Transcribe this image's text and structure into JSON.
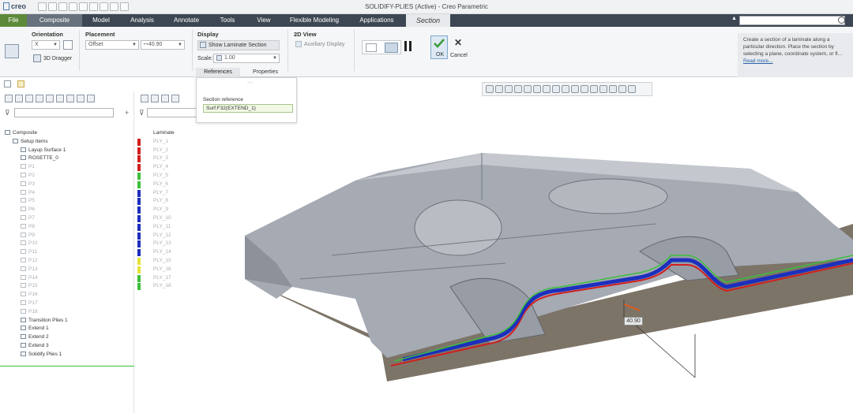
{
  "app": {
    "logo": "creo",
    "window_title": "SOLIDIFY-PLIES (Active) - Creo Parametric"
  },
  "menu": {
    "tabs": [
      "File",
      "Composite",
      "Model",
      "Analysis",
      "Annotate",
      "Tools",
      "View",
      "Flexible Modeling",
      "Applications",
      "Section"
    ]
  },
  "ribbon": {
    "orientation": {
      "label": "Orientation",
      "direction_value": "X",
      "dragger_label": "3D Dragger"
    },
    "placement": {
      "label": "Placement",
      "type_value": "Offset",
      "offset_value": "40.90"
    },
    "display": {
      "label": "Display",
      "show_laminate_label": "Show Laminate Section",
      "scale_label": "Scale:",
      "scale_value": "1.00"
    },
    "view2d": {
      "label": "2D View",
      "aux_label": "Auxiliary Display"
    },
    "ok_label": "OK",
    "cancel_label": "Cancel",
    "subtabs": [
      "References",
      "Properties"
    ]
  },
  "help": {
    "text": "Create a section of a laminate along a particular direction. Place the section by selecting a plane, coordinate system, or fl...",
    "link": "Read more..."
  },
  "references": {
    "label": "Section reference",
    "value": "Surf:F32(EXTEND_1)"
  },
  "tree": {
    "items": [
      {
        "label": "Composite",
        "dim": false,
        "indent": 0
      },
      {
        "label": "Setup Items",
        "dim": false,
        "indent": 1
      },
      {
        "label": "Layup Surface 1",
        "dim": false,
        "indent": 2
      },
      {
        "label": "ROSETTE_0",
        "dim": false,
        "indent": 2
      },
      {
        "label": "P1",
        "dim": true,
        "indent": 2
      },
      {
        "label": "P2",
        "dim": true,
        "indent": 2
      },
      {
        "label": "P3",
        "dim": true,
        "indent": 2
      },
      {
        "label": "P4",
        "dim": true,
        "indent": 2
      },
      {
        "label": "P5",
        "dim": true,
        "indent": 2
      },
      {
        "label": "P6",
        "dim": true,
        "indent": 2
      },
      {
        "label": "P7",
        "dim": true,
        "indent": 2
      },
      {
        "label": "P8",
        "dim": true,
        "indent": 2
      },
      {
        "label": "P9",
        "dim": true,
        "indent": 2
      },
      {
        "label": "P10",
        "dim": true,
        "indent": 2
      },
      {
        "label": "P11",
        "dim": true,
        "indent": 2
      },
      {
        "label": "P12",
        "dim": true,
        "indent": 2
      },
      {
        "label": "P13",
        "dim": true,
        "indent": 2
      },
      {
        "label": "P14",
        "dim": true,
        "indent": 2
      },
      {
        "label": "P15",
        "dim": true,
        "indent": 2
      },
      {
        "label": "P16",
        "dim": true,
        "indent": 2
      },
      {
        "label": "P17",
        "dim": true,
        "indent": 2
      },
      {
        "label": "P18",
        "dim": true,
        "indent": 2
      },
      {
        "label": "Transition Plies 1",
        "dim": false,
        "indent": 2
      },
      {
        "label": "Extend 1",
        "dim": false,
        "indent": 2
      },
      {
        "label": "Extend 2",
        "dim": false,
        "indent": 2
      },
      {
        "label": "Extend 3",
        "dim": false,
        "indent": 2
      },
      {
        "label": "Solidify Plies 1",
        "dim": false,
        "indent": 2
      }
    ]
  },
  "laminate": {
    "header": "Laminate",
    "plies": [
      {
        "label": "PLY_1",
        "color": "#d11f1f"
      },
      {
        "label": "PLY_2",
        "color": "#d11f1f"
      },
      {
        "label": "PLY_3",
        "color": "#d11f1f"
      },
      {
        "label": "PLY_4",
        "color": "#d11f1f"
      },
      {
        "label": "PLY_5",
        "color": "#3bbf3b"
      },
      {
        "label": "PLY_6",
        "color": "#3bbf3b"
      },
      {
        "label": "PLY_7",
        "color": "#1c2fbd"
      },
      {
        "label": "PLY_8",
        "color": "#1c2fbd"
      },
      {
        "label": "PLY_9",
        "color": "#1c2fbd"
      },
      {
        "label": "PLY_10",
        "color": "#1c2fbd"
      },
      {
        "label": "PLY_11",
        "color": "#1c2fbd"
      },
      {
        "label": "PLY_12",
        "color": "#1c2fbd"
      },
      {
        "label": "PLY_13",
        "color": "#1c2fbd"
      },
      {
        "label": "PLY_14",
        "color": "#1c2fbd"
      },
      {
        "label": "PLY_15",
        "color": "#e3e338"
      },
      {
        "label": "PLY_16",
        "color": "#e3e338"
      },
      {
        "label": "PLY_17",
        "color": "#3bbf3b"
      },
      {
        "label": "PLY_18",
        "color": "#3bbf3b"
      }
    ]
  },
  "viewport": {
    "dimension_value": "40.90"
  }
}
